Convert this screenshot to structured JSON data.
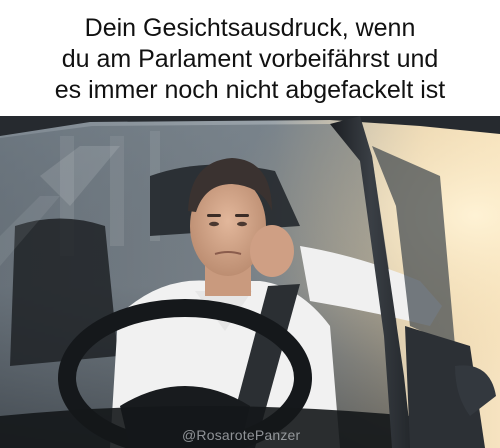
{
  "meme": {
    "caption_lines": [
      "Dein Gesichtsausdruck, wenn",
      "du am Parlament vorbeifährst und",
      "es immer noch nicht abgefackelt ist"
    ],
    "watermark": "@RosarotePanzer"
  },
  "colors": {
    "caption_background": "#ffffff",
    "caption_text": "#111111",
    "car_body": "#2b2f34",
    "shirt": "#f2f2f2",
    "sunlight": "#f3d9a8"
  }
}
